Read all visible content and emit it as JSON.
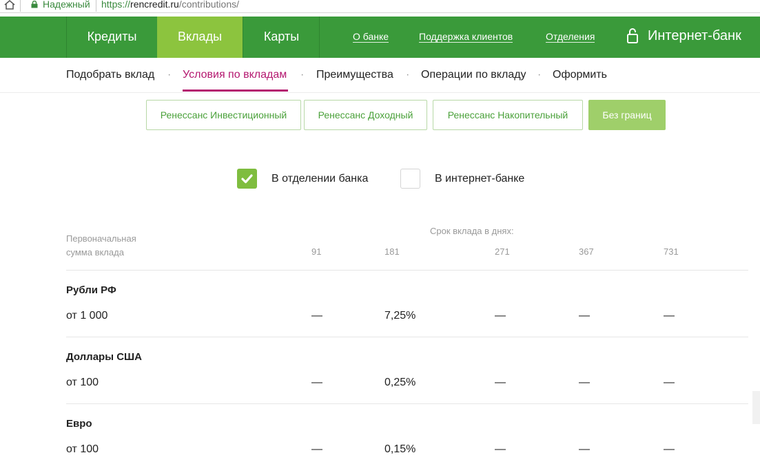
{
  "browser": {
    "secure_label": "Надежный",
    "url_scheme": "https://",
    "url_host": "rencredit.ru",
    "url_path": "/contributions/"
  },
  "main_nav": {
    "tabs": [
      "Кредиты",
      "Вклады",
      "Карты"
    ],
    "active_tab": "Вклады",
    "links": [
      "О банке",
      "Поддержка клиентов",
      "Отделения"
    ],
    "internet_bank": "Интернет-банк"
  },
  "sub_nav": {
    "items": [
      "Подобрать вклад",
      "Условия по вкладам",
      "Преимущества",
      "Операции по вкладу",
      "Оформить"
    ],
    "active": "Условия по вкладам"
  },
  "products": {
    "items": [
      "Ренессанс Инвестиционный",
      "Ренессанс Доходный",
      "Ренессанс Накопительный",
      "Без границ"
    ],
    "active": "Без границ"
  },
  "channels": [
    {
      "label": "В отделении банка",
      "checked": true
    },
    {
      "label": "В интернет-банке",
      "checked": false
    }
  ],
  "table": {
    "amount_header_line1": "Первоначальная",
    "amount_header_line2": "сумма вклада",
    "term_header": "Срок вклада в днях:",
    "terms": [
      "91",
      "181",
      "271",
      "367",
      "731"
    ],
    "rows": [
      {
        "currency": "Рубли РФ",
        "amount": "от 1 000",
        "rates": [
          "—",
          "7,25%",
          "—",
          "—",
          "—"
        ]
      },
      {
        "currency": "Доллары США",
        "amount": "от 100",
        "rates": [
          "—",
          "0,25%",
          "—",
          "—",
          "—"
        ]
      },
      {
        "currency": "Евро",
        "amount": "от 100",
        "rates": [
          "—",
          "0,15%",
          "—",
          "—",
          "—"
        ]
      }
    ]
  },
  "colors": {
    "nav_green": "#3a9a3a",
    "active_tab_green": "#8cc43e",
    "accent_magenta": "#b4176f",
    "button_green_text": "#4aa13a"
  }
}
